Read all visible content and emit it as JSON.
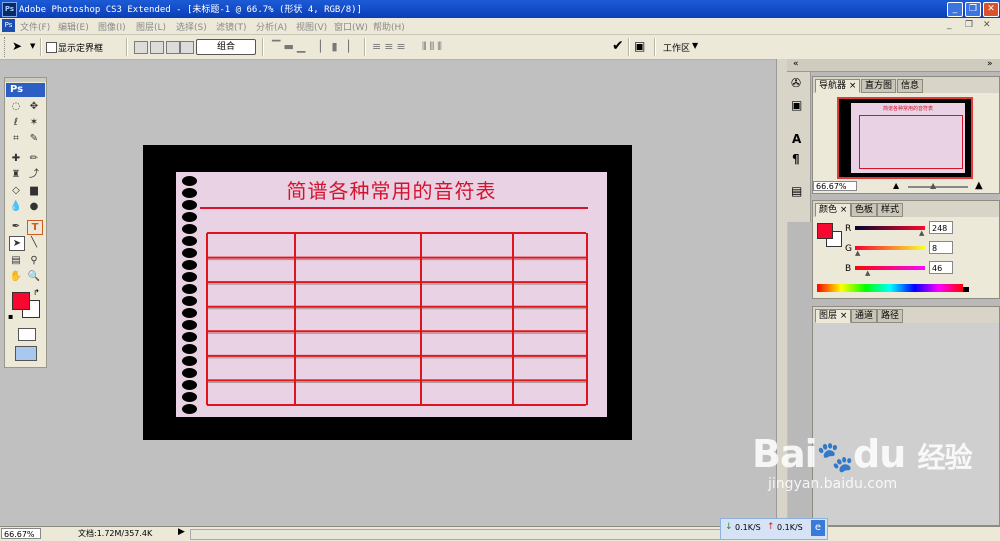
{
  "window": {
    "title": "Adobe Photoshop CS3 Extended - [未标题-1 @ 66.7% (形状 4, RGB/8)]",
    "logo": "Ps"
  },
  "menu": [
    "文件(F)",
    "编辑(E)",
    "图像(I)",
    "图层(L)",
    "选择(S)",
    "滤镜(T)",
    "分析(A)",
    "视图(V)",
    "窗口(W)",
    "帮助(H)"
  ],
  "options": {
    "show_bounds_label": "显示定界框",
    "combine_label": "组合",
    "workspace_label": "工作区"
  },
  "toolbox": {
    "badge": "Ps"
  },
  "document": {
    "title_text": "简谱各种常用的音符表",
    "table_rows": 7,
    "table_cols": 4
  },
  "navigator": {
    "tabs": [
      "导航器",
      "直方图",
      "信息"
    ],
    "zoom": "66.67%",
    "preview_title": "简谱各种常用的音符表"
  },
  "color": {
    "tabs": [
      "颜色",
      "色板",
      "样式"
    ],
    "r_label": "R",
    "g_label": "G",
    "b_label": "B",
    "r_value": "248",
    "g_value": "8",
    "b_value": "46",
    "foreground": "#f8082e"
  },
  "layers": {
    "tabs": [
      "图层",
      "通道",
      "路径"
    ]
  },
  "status": {
    "zoom": "66.67%",
    "doc_info": "文档:1.72M/357.4K"
  },
  "network": {
    "down": "0.1K/S",
    "up": "0.1K/S"
  },
  "watermark": {
    "brand": "Bai",
    "brand2": "du",
    "cn": "经验",
    "url": "jingyan.baidu.com"
  }
}
